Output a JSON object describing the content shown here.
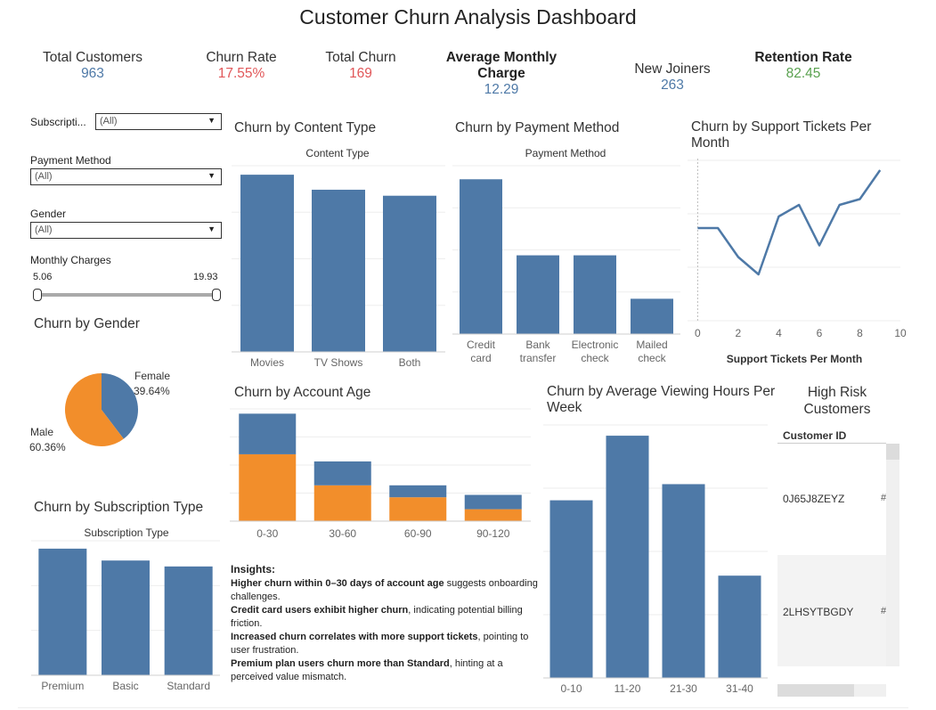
{
  "header": {
    "title": "Customer Churn Analysis Dashboard"
  },
  "kpis": {
    "total_customers": {
      "label": "Total Customers",
      "value": "963"
    },
    "churn_rate": {
      "label": "Churn Rate",
      "value": "17.55%"
    },
    "total_churn": {
      "label": "Total  Churn",
      "value": "169"
    },
    "avg_monthly_charge": {
      "label_line1": "Average Monthly",
      "label_line2": "Charge",
      "value": "12.29"
    },
    "new_joiners": {
      "label": "New Joiners",
      "value": "263"
    },
    "retention_rate": {
      "label": "Retention Rate",
      "value": "82.45"
    }
  },
  "filters": {
    "subscription": {
      "label": "Subscripti...",
      "value": "(All)"
    },
    "payment_method": {
      "label": "Payment Method",
      "value": "(All)"
    },
    "gender": {
      "label": "Gender",
      "value": "(All)"
    },
    "monthly_charges": {
      "label": "Monthly Charges",
      "min": "5.06",
      "max": "19.93"
    }
  },
  "colors": {
    "blue": "#4e79a7",
    "orange": "#f28e2b",
    "kpi_blue": "#4e79a7",
    "kpi_red": "#e15759",
    "kpi_green": "#59a14f"
  },
  "sections": {
    "content_type": "Churn by Content Type",
    "payment_method": "Churn by Payment Method",
    "support_tickets_line1": "Churn by Support Tickets Per",
    "support_tickets_line2": "Month",
    "gender": "Churn by Gender",
    "account_age": "Churn by Account Age",
    "viewing_hours_line1": "Churn by Average Viewing Hours Per",
    "viewing_hours_line2": "Week",
    "high_risk_line1": "High Risk",
    "high_risk_line2": "Customers",
    "subscription": "Churn by Subscription Type"
  },
  "chart_data": [
    {
      "id": "content_type",
      "type": "bar",
      "title": "Content Type",
      "categories": [
        "Movies",
        "TV Shows",
        "Both"
      ],
      "values": [
        59,
        54,
        52
      ],
      "ylim": [
        0,
        62
      ]
    },
    {
      "id": "payment_method",
      "type": "bar",
      "title": "Payment Method",
      "categories": [
        [
          "Credit",
          "card"
        ],
        [
          "Bank",
          "transfer"
        ],
        [
          "Electronic",
          "check"
        ],
        [
          "Mailed",
          "check"
        ]
      ],
      "values": [
        57,
        29,
        29,
        13
      ],
      "ylim": [
        0,
        62
      ]
    },
    {
      "id": "support_tickets",
      "type": "line",
      "xlabel": "Support Tickets Per Month",
      "x": [
        0,
        1,
        2,
        3,
        4,
        5,
        6,
        7,
        8,
        9
      ],
      "values": [
        16,
        16,
        11,
        8,
        18,
        20,
        13,
        20,
        21,
        26
      ],
      "xlim": [
        -0.5,
        10
      ],
      "ylim": [
        0,
        28
      ],
      "xticks": [
        "0",
        "2",
        "4",
        "6",
        "8",
        "10"
      ]
    },
    {
      "id": "gender",
      "type": "pie",
      "slices": [
        {
          "label": "Female",
          "percent": "39.64%",
          "value": 39.64,
          "color": "#4e79a7"
        },
        {
          "label": "Male",
          "percent": "60.36%",
          "value": 60.36,
          "color": "#f28e2b"
        }
      ]
    },
    {
      "id": "account_age",
      "type": "bar",
      "stacked": true,
      "categories": [
        "0-30",
        "30-60",
        "60-90",
        "90-120"
      ],
      "series": [
        {
          "values": [
            28,
            15,
            10,
            5
          ],
          "color": "#f28e2b"
        },
        {
          "values": [
            17,
            10,
            5,
            6
          ],
          "color": "#4e79a7"
        }
      ],
      "ylim": [
        0,
        47
      ]
    },
    {
      "id": "viewing_hours",
      "type": "bar",
      "categories": [
        "0-10",
        "11-20",
        "21-30",
        "31-40"
      ],
      "values": [
        33,
        45,
        36,
        19
      ],
      "ylim": [
        0,
        47
      ]
    },
    {
      "id": "subscription",
      "type": "bar",
      "title": "Subscription Type",
      "categories": [
        "Premium",
        "Basic",
        "Standard"
      ],
      "values": [
        64,
        58,
        55
      ],
      "ylim": [
        0,
        68
      ]
    }
  ],
  "high_risk": {
    "column": "Customer ID",
    "rows": [
      {
        "id": "0J65J8ZEYZ",
        "mark": "#"
      },
      {
        "id": "2LHSYTBGDY",
        "mark": "#"
      }
    ]
  },
  "insights": {
    "heading": "Insights:",
    "items": [
      {
        "bold": "Higher churn within 0–30 days of account age",
        "rest": " suggests onboarding challenges."
      },
      {
        "bold": "Credit card users exhibit higher churn",
        "rest": ", indicating potential billing friction."
      },
      {
        "bold": "Increased churn correlates with more support tickets",
        "rest": ", pointing to user frustration."
      },
      {
        "bold": "Premium plan users churn more than Standard",
        "rest": ", hinting at a perceived value mismatch."
      }
    ]
  }
}
